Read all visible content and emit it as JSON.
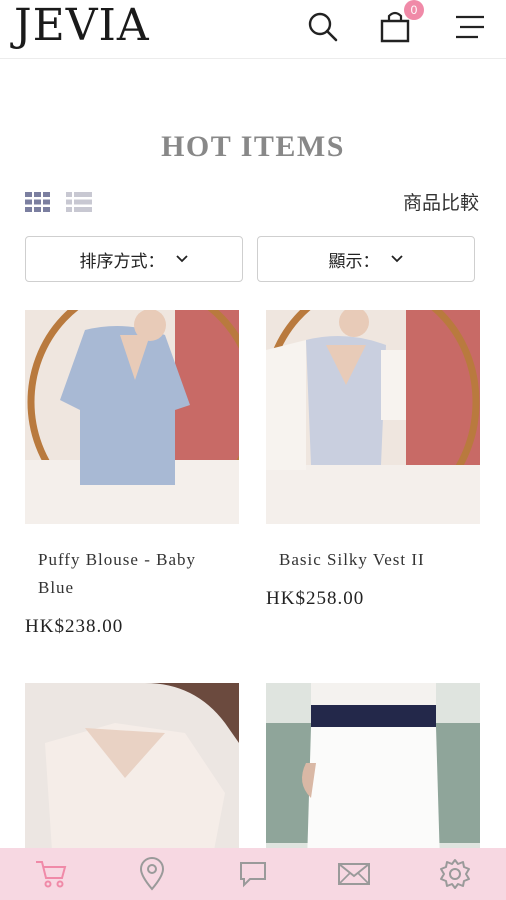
{
  "header": {
    "logo": "JEVIA",
    "cart_count": "0",
    "icons": [
      "search-icon",
      "shopping-bag-icon",
      "menu-icon"
    ]
  },
  "page": {
    "title": "HOT ITEMS",
    "compare_label": "商品比較",
    "sort_label": "排序方式：",
    "display_label": "顯示："
  },
  "products": [
    {
      "name": "Puffy Blouse - Baby Blue",
      "price": "HK$238.00"
    },
    {
      "name": "Basic Silky Vest II",
      "price": "HK$258.00"
    },
    {
      "name": "",
      "price": ""
    },
    {
      "name": "",
      "price": ""
    }
  ],
  "tabbar": {
    "icons": [
      "cart-icon",
      "location-pin-icon",
      "chat-icon",
      "mail-icon",
      "settings-icon"
    ],
    "active_color": "#f08aa8",
    "inactive_color": "#9a9a9a"
  },
  "colors": {
    "accent": "#f08aa8",
    "tabbar_bg": "#f7d8e2",
    "view_active": "#7b7fa0"
  }
}
